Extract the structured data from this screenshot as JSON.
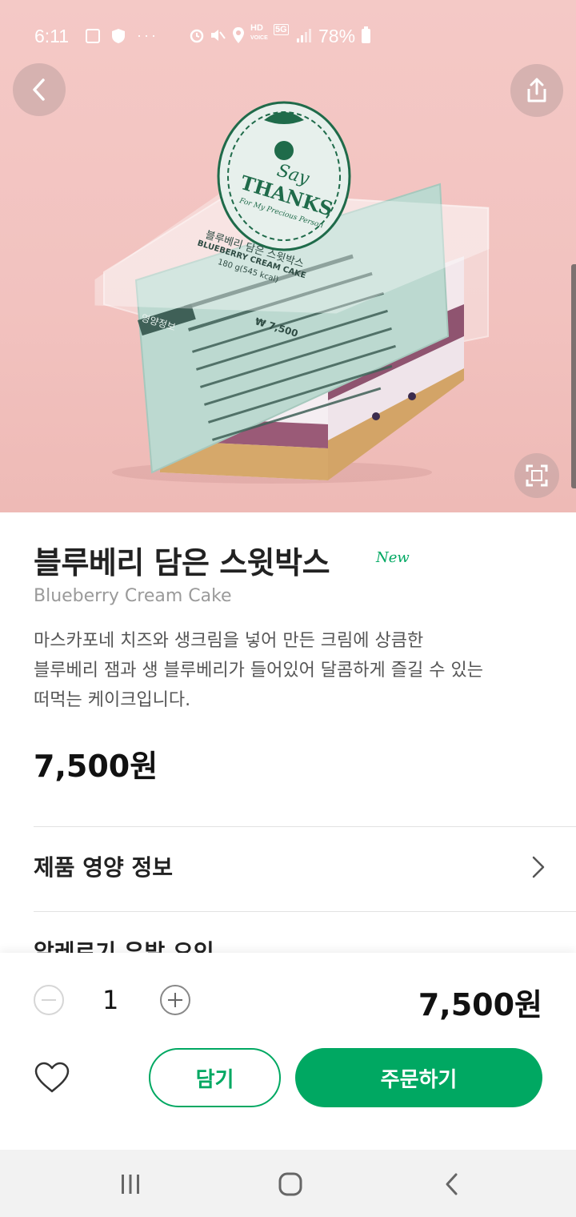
{
  "status_bar": {
    "time": "6:11",
    "battery": "78%",
    "icons": [
      "gallery-icon",
      "shield-icon",
      "more-dots-icon",
      "alarm-icon",
      "mute-icon",
      "location-icon",
      "hd-voice-icon",
      "5g-icon",
      "signal-icon",
      "battery-icon"
    ]
  },
  "hero": {
    "package_label_title": "블루베리 담은 스윗박스",
    "package_label_en": "BLUEBERRY CREAM CAKE",
    "package_label_weight": "180 g(545 kcal)",
    "package_label_price": "₩ 7,500",
    "tag_line1": "Say",
    "tag_line2": "THANKS",
    "tag_line3": "For My Precious Person",
    "nutrition_header": "영양정보"
  },
  "product": {
    "name": "블루베리 담은 스윗박스",
    "badge": "New",
    "name_en": "Blueberry Cream Cake",
    "description_lines": [
      "마스카포네 치즈와 생크림을 넣어 만든 크림에 상큼한",
      "블루베리 잼과 생 블루베리가 들어있어 달콤하게 즐길 수 있는",
      "떠먹는 케이크입니다."
    ],
    "price": "7,500원"
  },
  "sections": {
    "nutrition_label": "제품 영양 정보",
    "allergy_label": "알레르기 유발 요인"
  },
  "order_bar": {
    "quantity": "1",
    "total": "7,500원",
    "cart_label": "담기",
    "order_label": "주문하기"
  },
  "colors": {
    "brand_green": "#00a862",
    "hero_pink": "#f2c2bf",
    "label_mint": "#b9d8cf"
  }
}
